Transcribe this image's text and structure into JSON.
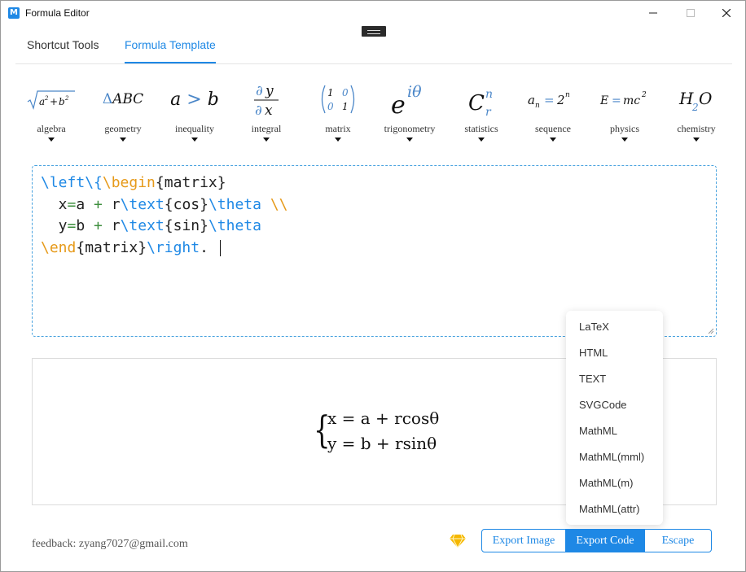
{
  "window": {
    "title": "Formula Editor",
    "app_icon_letter": "M"
  },
  "tabs": [
    {
      "label": "Shortcut Tools",
      "active": false
    },
    {
      "label": "Formula Template",
      "active": true
    }
  ],
  "templates": [
    {
      "label": "algebra",
      "formula": "√(a² + b²)"
    },
    {
      "label": "geometry",
      "formula": "ΔABC"
    },
    {
      "label": "inequality",
      "formula": "a > b"
    },
    {
      "label": "integral",
      "formula": "∂y/∂x"
    },
    {
      "label": "matrix",
      "formula": "(1 0; 0 1)"
    },
    {
      "label": "trigonometry",
      "formula": "e^iθ"
    },
    {
      "label": "statistics",
      "formula": "C_r^n"
    },
    {
      "label": "sequence",
      "formula": "a_n = 2^n"
    },
    {
      "label": "physics",
      "formula": "E = mc²"
    },
    {
      "label": "chemistry",
      "formula": "H₂O"
    }
  ],
  "editor": {
    "lines": [
      "\\left\\{\\begin{matrix}",
      "  x=a + r\\text{cos}\\theta \\\\",
      "  y=b + r\\text{sin}\\theta",
      "\\end{matrix}\\right. "
    ]
  },
  "preview": {
    "line1": "x = a + rcosθ",
    "line2": "y = b + rsinθ"
  },
  "export_menu": [
    "LaTeX",
    "HTML",
    "TEXT",
    "SVGCode",
    "MathML",
    "MathML(mml)",
    "MathML(m)",
    "MathML(attr)"
  ],
  "footer": {
    "feedback": "feedback: zyang7027@gmail.com",
    "buttons": {
      "export_image": "Export Image",
      "export_code": "Export Code",
      "escape": "Escape"
    }
  },
  "colors": {
    "accent": "#1e88e5",
    "keyword_orange": "#e69a1a",
    "diamond": "#f5b700"
  }
}
